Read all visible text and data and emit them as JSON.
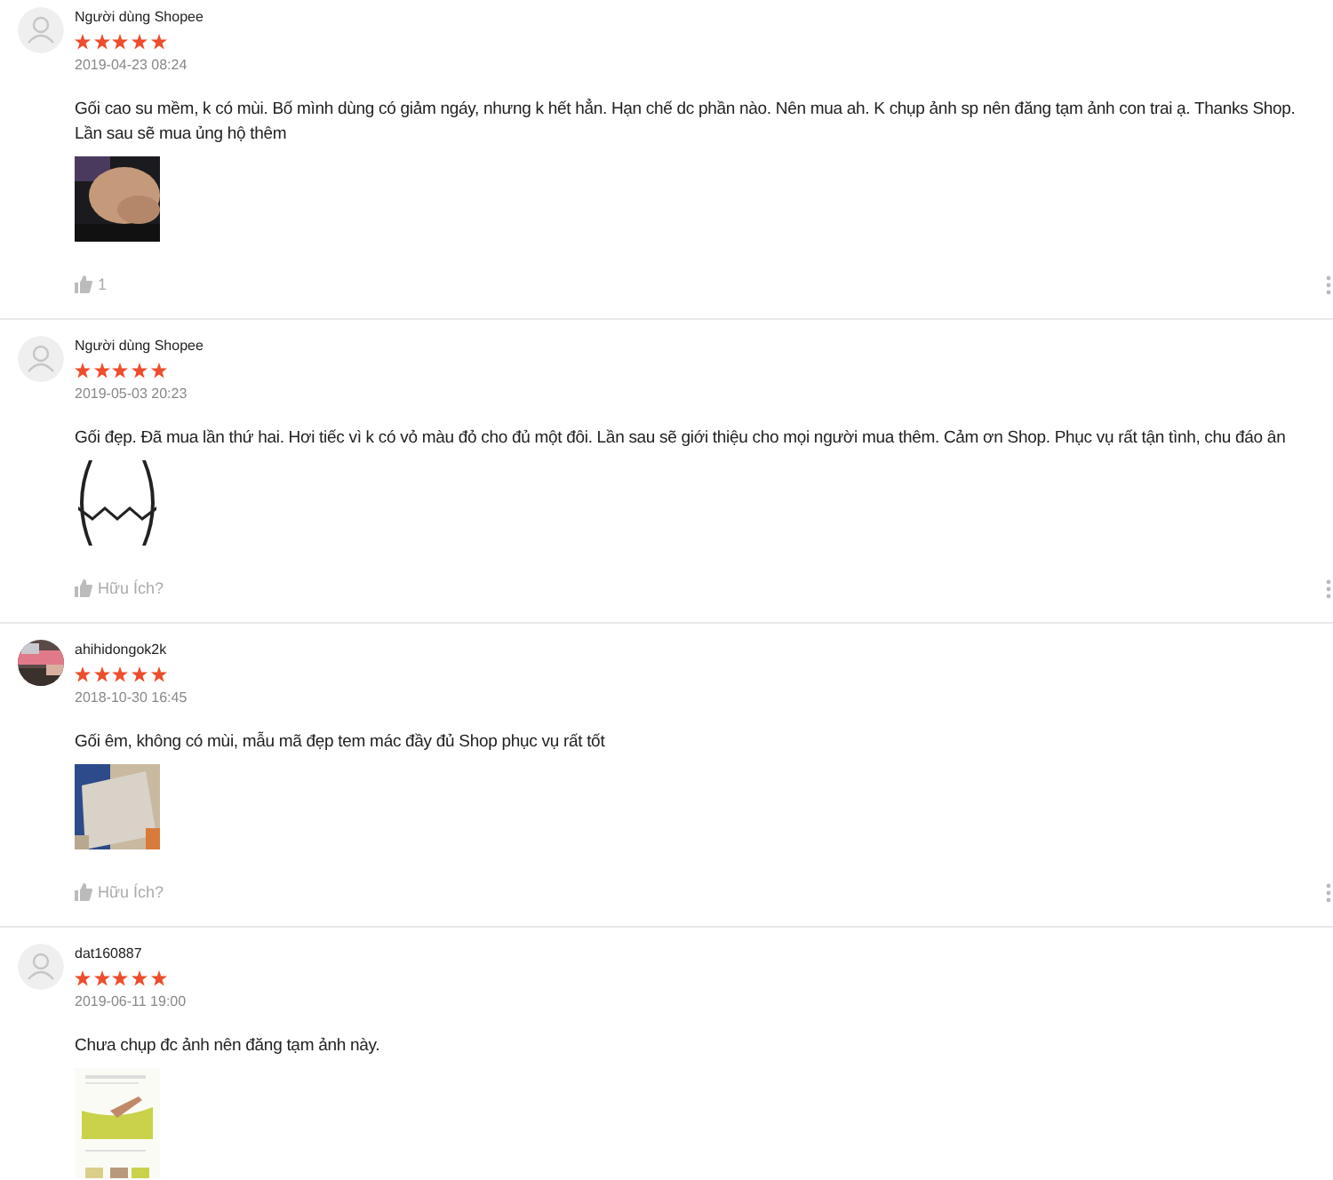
{
  "reviews": [
    {
      "author": "Người dùng Shopee",
      "avatar": {
        "kind": "default"
      },
      "stars": 5,
      "date": "2019-04-23 08:24",
      "text": "Gối cao su mềm, k có mùi. Bố mình dùng có giảm ngáy, nhưng k hết hẳn. Hạn chế dc phần nào. Nên mua ah. K chụp ảnh sp nên đăng tạm ảnh con trai ạ. Thanks Shop. Lần sau sẽ mua ủng hộ thêm",
      "images": [
        {
          "kind": "picture"
        }
      ],
      "helpful": "1"
    },
    {
      "author": "Người dùng Shopee",
      "avatar": {
        "kind": "default"
      },
      "stars": 5,
      "date": "2019-05-03 20:23",
      "text": "Gối đẹp. Đã mua lần thứ hai. Hơi tiếc vì k có vỏ màu đỏ cho đủ một đôi. Lần sau sẽ giới thiệu cho mọi người mua thêm. Cảm ơn Shop. Phục vụ rất tận tình, chu đáo ân",
      "images": [
        {
          "kind": "picture"
        }
      ],
      "helpful": "Hữu Ích?"
    },
    {
      "author": "ahihidongok2k",
      "avatar": {
        "kind": "picture"
      },
      "stars": 5,
      "date": "2018-10-30 16:45",
      "text": "Gối êm, không có mùi, mẫu mã đẹp tem mác đầy đủ Shop phục vụ rất tốt",
      "images": [
        {
          "kind": "picture"
        }
      ],
      "helpful": "Hữu Ích?"
    },
    {
      "author": "dat160887",
      "avatar": {
        "kind": "default"
      },
      "stars": 5,
      "date": "2019-06-11 19:00",
      "text": "Chưa chụp đc ảnh nên đăng tạm ảnh này.",
      "images": [
        {
          "kind": "picture"
        }
      ]
    }
  ]
}
